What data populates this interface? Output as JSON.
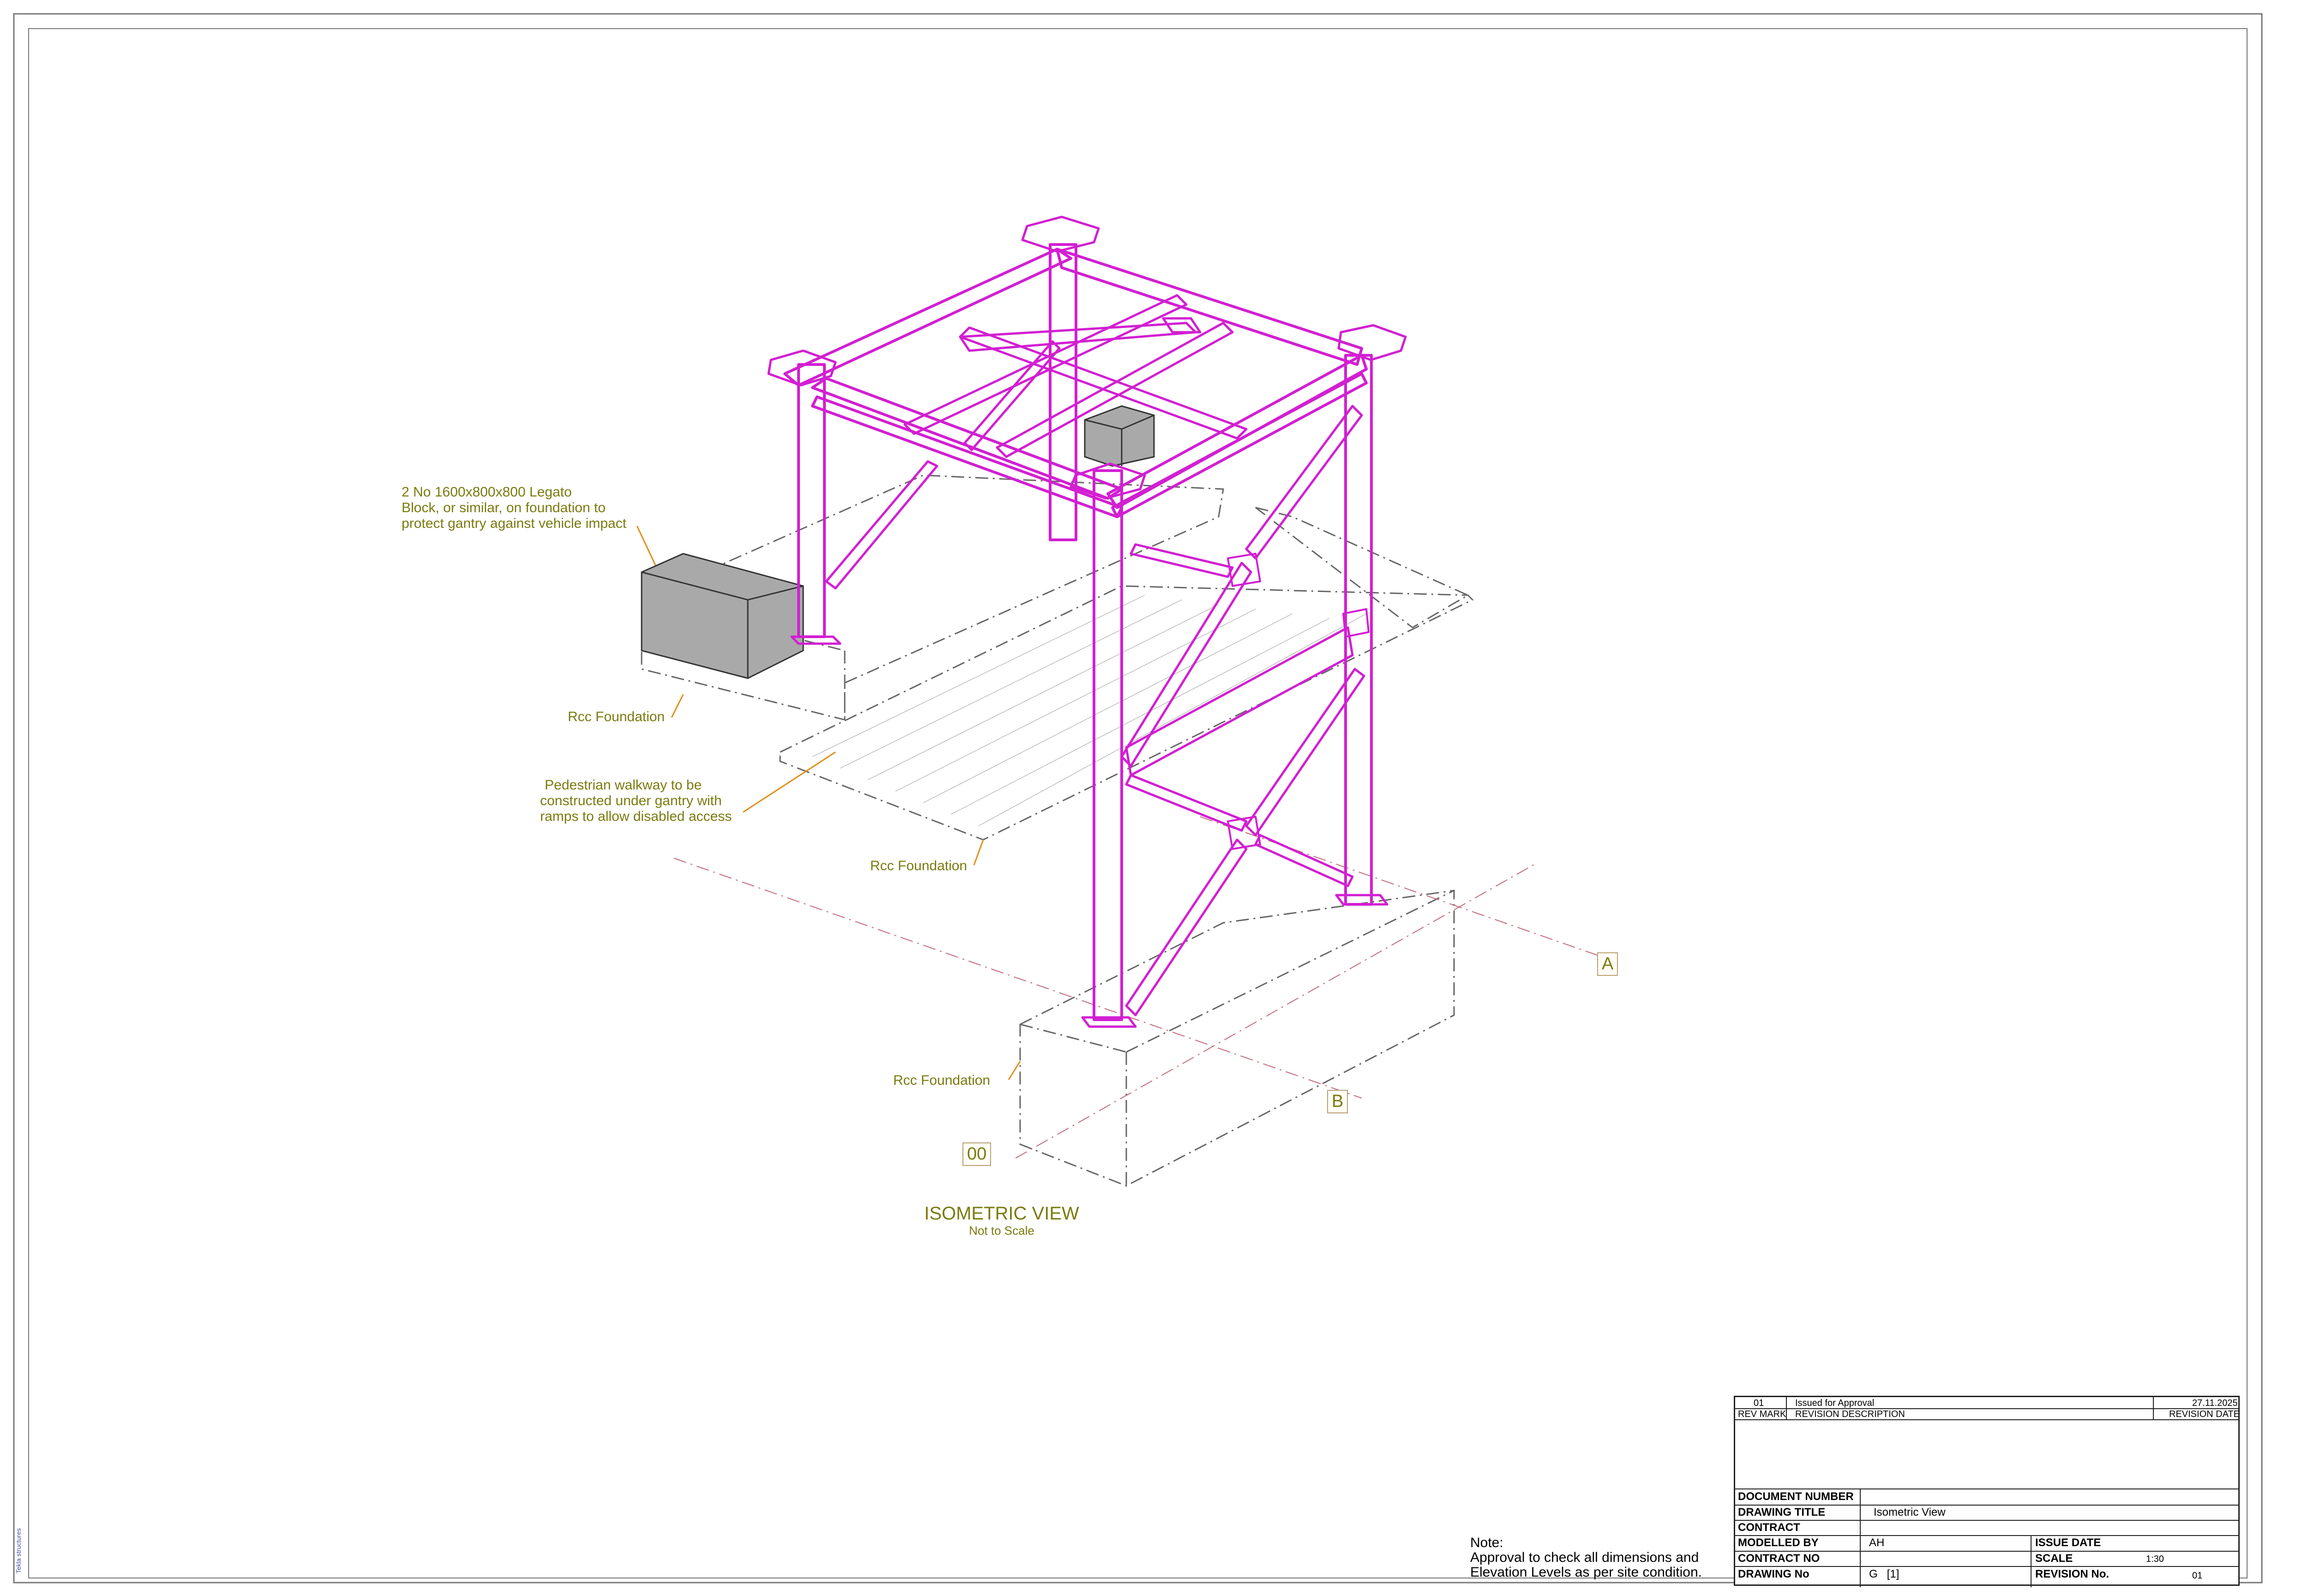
{
  "annotations": {
    "legato_block": [
      "2 No 1600x800x800 Legato",
      "Block, or similar, on foundation to",
      "protect gantry against vehicle impact"
    ],
    "rcc_foundation_1": "Rcc Foundation",
    "walkway": [
      "Pedestrian walkway to be",
      "constructed under gantry with",
      "ramps to allow disabled access"
    ],
    "rcc_foundation_2": "Rcc Foundation",
    "rcc_foundation_3": "Rcc Foundation"
  },
  "grid_labels": {
    "a": "A",
    "b": "B",
    "level": "00"
  },
  "view": {
    "title": "ISOMETRIC VIEW",
    "subtitle": "Not to Scale"
  },
  "side_text": "Tekla structures",
  "note": {
    "heading": "Note:",
    "line1": "Approval to check all dimensions and",
    "line2": "Elevation Levels as per site condition."
  },
  "title_block": {
    "revision": {
      "mark": "01",
      "description": "Issued for Approval",
      "date": "27.11.2025",
      "mark_header": "REV MARK",
      "description_header": "REVISION DESCRIPTION",
      "date_header": "REVISION DATE"
    },
    "document_number_label": "DOCUMENT NUMBER",
    "drawing_title_label": "DRAWING TITLE",
    "drawing_title_value": "Isometric View",
    "contract_label": "CONTRACT",
    "modelled_by_label": "MODELLED BY",
    "modelled_by_value": "AH",
    "issue_date_label": "ISSUE DATE",
    "contract_no_label": "CONTRACT NO",
    "scale_label": "SCALE",
    "scale_value": "1:30",
    "drawing_no_label": "DRAWING No",
    "drawing_no_value": "G   [1]",
    "revision_no_label": "REVISION No.",
    "revision_no_value": "01"
  },
  "colors": {
    "steel": "#d21fd2",
    "annotation": "#7a7a10",
    "leader": "#e0901a",
    "block": "#a9a9a9",
    "frame": "#555555"
  }
}
